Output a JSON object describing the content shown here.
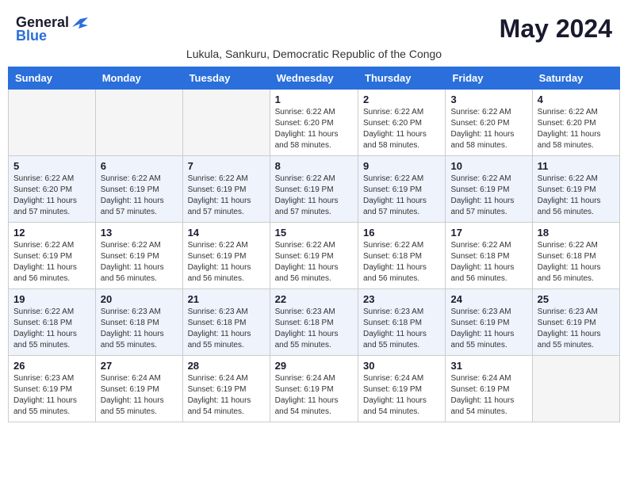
{
  "header": {
    "logo_general": "General",
    "logo_blue": "Blue",
    "month_title": "May 2024",
    "location": "Lukula, Sankuru, Democratic Republic of the Congo"
  },
  "weekdays": [
    "Sunday",
    "Monday",
    "Tuesday",
    "Wednesday",
    "Thursday",
    "Friday",
    "Saturday"
  ],
  "weeks": [
    [
      {
        "day": "",
        "info": ""
      },
      {
        "day": "",
        "info": ""
      },
      {
        "day": "",
        "info": ""
      },
      {
        "day": "1",
        "info": "Sunrise: 6:22 AM\nSunset: 6:20 PM\nDaylight: 11 hours and 58 minutes."
      },
      {
        "day": "2",
        "info": "Sunrise: 6:22 AM\nSunset: 6:20 PM\nDaylight: 11 hours and 58 minutes."
      },
      {
        "day": "3",
        "info": "Sunrise: 6:22 AM\nSunset: 6:20 PM\nDaylight: 11 hours and 58 minutes."
      },
      {
        "day": "4",
        "info": "Sunrise: 6:22 AM\nSunset: 6:20 PM\nDaylight: 11 hours and 58 minutes."
      }
    ],
    [
      {
        "day": "5",
        "info": "Sunrise: 6:22 AM\nSunset: 6:20 PM\nDaylight: 11 hours and 57 minutes."
      },
      {
        "day": "6",
        "info": "Sunrise: 6:22 AM\nSunset: 6:19 PM\nDaylight: 11 hours and 57 minutes."
      },
      {
        "day": "7",
        "info": "Sunrise: 6:22 AM\nSunset: 6:19 PM\nDaylight: 11 hours and 57 minutes."
      },
      {
        "day": "8",
        "info": "Sunrise: 6:22 AM\nSunset: 6:19 PM\nDaylight: 11 hours and 57 minutes."
      },
      {
        "day": "9",
        "info": "Sunrise: 6:22 AM\nSunset: 6:19 PM\nDaylight: 11 hours and 57 minutes."
      },
      {
        "day": "10",
        "info": "Sunrise: 6:22 AM\nSunset: 6:19 PM\nDaylight: 11 hours and 57 minutes."
      },
      {
        "day": "11",
        "info": "Sunrise: 6:22 AM\nSunset: 6:19 PM\nDaylight: 11 hours and 56 minutes."
      }
    ],
    [
      {
        "day": "12",
        "info": "Sunrise: 6:22 AM\nSunset: 6:19 PM\nDaylight: 11 hours and 56 minutes."
      },
      {
        "day": "13",
        "info": "Sunrise: 6:22 AM\nSunset: 6:19 PM\nDaylight: 11 hours and 56 minutes."
      },
      {
        "day": "14",
        "info": "Sunrise: 6:22 AM\nSunset: 6:19 PM\nDaylight: 11 hours and 56 minutes."
      },
      {
        "day": "15",
        "info": "Sunrise: 6:22 AM\nSunset: 6:19 PM\nDaylight: 11 hours and 56 minutes."
      },
      {
        "day": "16",
        "info": "Sunrise: 6:22 AM\nSunset: 6:18 PM\nDaylight: 11 hours and 56 minutes."
      },
      {
        "day": "17",
        "info": "Sunrise: 6:22 AM\nSunset: 6:18 PM\nDaylight: 11 hours and 56 minutes."
      },
      {
        "day": "18",
        "info": "Sunrise: 6:22 AM\nSunset: 6:18 PM\nDaylight: 11 hours and 56 minutes."
      }
    ],
    [
      {
        "day": "19",
        "info": "Sunrise: 6:22 AM\nSunset: 6:18 PM\nDaylight: 11 hours and 55 minutes."
      },
      {
        "day": "20",
        "info": "Sunrise: 6:23 AM\nSunset: 6:18 PM\nDaylight: 11 hours and 55 minutes."
      },
      {
        "day": "21",
        "info": "Sunrise: 6:23 AM\nSunset: 6:18 PM\nDaylight: 11 hours and 55 minutes."
      },
      {
        "day": "22",
        "info": "Sunrise: 6:23 AM\nSunset: 6:18 PM\nDaylight: 11 hours and 55 minutes."
      },
      {
        "day": "23",
        "info": "Sunrise: 6:23 AM\nSunset: 6:18 PM\nDaylight: 11 hours and 55 minutes."
      },
      {
        "day": "24",
        "info": "Sunrise: 6:23 AM\nSunset: 6:19 PM\nDaylight: 11 hours and 55 minutes."
      },
      {
        "day": "25",
        "info": "Sunrise: 6:23 AM\nSunset: 6:19 PM\nDaylight: 11 hours and 55 minutes."
      }
    ],
    [
      {
        "day": "26",
        "info": "Sunrise: 6:23 AM\nSunset: 6:19 PM\nDaylight: 11 hours and 55 minutes."
      },
      {
        "day": "27",
        "info": "Sunrise: 6:24 AM\nSunset: 6:19 PM\nDaylight: 11 hours and 55 minutes."
      },
      {
        "day": "28",
        "info": "Sunrise: 6:24 AM\nSunset: 6:19 PM\nDaylight: 11 hours and 54 minutes."
      },
      {
        "day": "29",
        "info": "Sunrise: 6:24 AM\nSunset: 6:19 PM\nDaylight: 11 hours and 54 minutes."
      },
      {
        "day": "30",
        "info": "Sunrise: 6:24 AM\nSunset: 6:19 PM\nDaylight: 11 hours and 54 minutes."
      },
      {
        "day": "31",
        "info": "Sunrise: 6:24 AM\nSunset: 6:19 PM\nDaylight: 11 hours and 54 minutes."
      },
      {
        "day": "",
        "info": ""
      }
    ]
  ]
}
